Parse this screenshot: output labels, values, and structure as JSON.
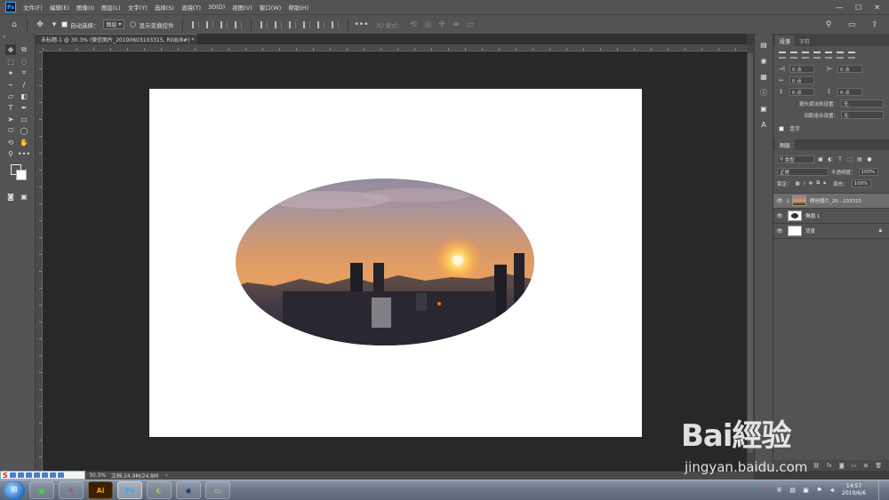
{
  "app": {
    "logo_text": "Ps"
  },
  "menu": [
    "文件(F)",
    "编辑(E)",
    "图像(I)",
    "图层(L)",
    "文字(Y)",
    "选择(S)",
    "滤镜(T)",
    "3D(D)",
    "视图(V)",
    "窗口(W)",
    "帮助(H)"
  ],
  "window_controls": {
    "minimize": "—",
    "maximize": "☐",
    "close": "✕"
  },
  "options": {
    "auto_select_label": "自动选择：",
    "auto_select_value": "图层",
    "show_transform_label": "显示变换控件",
    "mode_label": "3D 模式："
  },
  "document": {
    "tab_title": "未标题-1 @ 30.3% (微信图片_20190603103315, RGB/8#) *",
    "close": "×"
  },
  "status": {
    "zoom": "30.3%",
    "doc_size": "文档:24.9M/24.8M"
  },
  "paragraph_panel": {
    "tabs": [
      "段落",
      "字符"
    ],
    "fields": [
      {
        "icon": "→|",
        "value": "0 点"
      },
      {
        "icon": "|←",
        "value": "0 点"
      },
      {
        "icon": "↦",
        "value": "0 点"
      },
      {
        "icon": "↥",
        "value": "0 点"
      },
      {
        "icon": "↧",
        "value": "0 点"
      }
    ],
    "kinsoku_label": "避头尾法则设置：",
    "kinsoku_value": "无",
    "mojikumi_label": "间距组合设置：",
    "mojikumi_value": "无",
    "hyphenate_label": "连字"
  },
  "layers_panel": {
    "title": "图层",
    "filter_value": "类型",
    "blend_mode": "正常",
    "opacity_label": "不透明度：",
    "opacity_value": "100%",
    "lock_label": "锁定：",
    "fill_label": "填充：",
    "fill_value": "100%",
    "layers": [
      {
        "name": "微信图片_20...103315",
        "thumb": "photo",
        "selected": true
      },
      {
        "name": "椭圆 1",
        "thumb": "shape",
        "selected": false
      },
      {
        "name": "背景",
        "thumb": "white",
        "selected": false,
        "locked": true
      }
    ]
  },
  "taskbar": {
    "apps": [
      "",
      "",
      "Ai",
      "Ps",
      "",
      "",
      ""
    ],
    "clock_time": "14:57",
    "clock_date": "2019/6/6"
  },
  "watermark": {
    "brand": "Bai經验",
    "url": "jingyan.baidu.com"
  },
  "colors": {
    "ui_panel": "#535353",
    "workspace": "#282828",
    "canvas": "#ffffff",
    "ps_accent": "#31a8ff"
  }
}
